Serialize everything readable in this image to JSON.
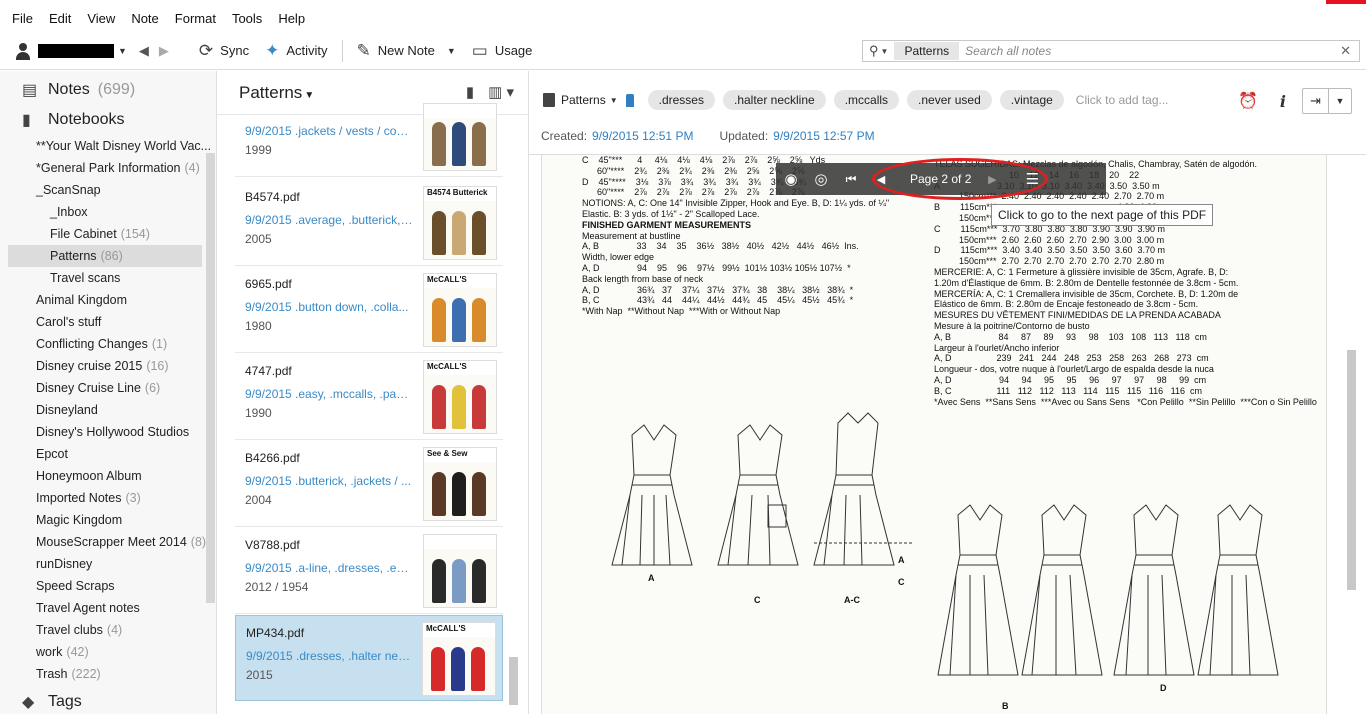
{
  "menu": [
    "File",
    "Edit",
    "View",
    "Note",
    "Format",
    "Tools",
    "Help"
  ],
  "toolbar": {
    "sync_label": "Sync",
    "activity_label": "Activity",
    "new_note_label": "New Note",
    "usage_label": "Usage"
  },
  "search": {
    "scope_tag": "Patterns",
    "placeholder": "Search all notes"
  },
  "sidebar": {
    "notes_label": "Notes",
    "notes_count": "(699)",
    "notebooks_label": "Notebooks",
    "tags_label": "Tags",
    "notebooks": [
      {
        "label": "**Your Walt Disney World Vac...",
        "count": "",
        "level": 0
      },
      {
        "label": "*General Park Information",
        "count": "(4)",
        "level": 0
      },
      {
        "label": "_ScanSnap",
        "count": "",
        "level": 0
      },
      {
        "label": "_Inbox",
        "count": "",
        "level": 1
      },
      {
        "label": "File Cabinet",
        "count": "(154)",
        "level": 1
      },
      {
        "label": "Patterns",
        "count": "(86)",
        "level": 1,
        "selected": true
      },
      {
        "label": "Travel scans",
        "count": "",
        "level": 1
      },
      {
        "label": "Animal Kingdom",
        "count": "",
        "level": 0
      },
      {
        "label": "Carol's stuff",
        "count": "",
        "level": 0
      },
      {
        "label": "Conflicting Changes",
        "count": "(1)",
        "level": 0
      },
      {
        "label": "Disney cruise 2015",
        "count": "(16)",
        "level": 0
      },
      {
        "label": "Disney Cruise Line",
        "count": "(6)",
        "level": 0
      },
      {
        "label": "Disneyland",
        "count": "",
        "level": 0
      },
      {
        "label": "Disney's Hollywood Studios",
        "count": "",
        "level": 0
      },
      {
        "label": "Epcot",
        "count": "",
        "level": 0
      },
      {
        "label": "Honeymoon Album",
        "count": "",
        "level": 0
      },
      {
        "label": "Imported Notes",
        "count": "(3)",
        "level": 0
      },
      {
        "label": "Magic Kingdom",
        "count": "",
        "level": 0
      },
      {
        "label": "MouseScrapper Meet 2014",
        "count": "(8)",
        "level": 0
      },
      {
        "label": "runDisney",
        "count": "",
        "level": 0
      },
      {
        "label": "Speed Scraps",
        "count": "",
        "level": 0
      },
      {
        "label": "Travel Agent notes",
        "count": "",
        "level": 0
      },
      {
        "label": "Travel clubs",
        "count": "(4)",
        "level": 0
      },
      {
        "label": "work",
        "count": "(42)",
        "level": 0
      },
      {
        "label": "Trash",
        "count": "(222)",
        "level": 0
      }
    ]
  },
  "notelist": {
    "title": "Patterns",
    "notes": [
      {
        "title": "",
        "meta": "9/9/2015  .jackets / vests / coa...",
        "year": "1999",
        "thumb_label": "",
        "colors": [
          "#8a6d4a",
          "#2e4a7a"
        ]
      },
      {
        "title": "B4574.pdf",
        "meta": "9/9/2015  .average, .butterick, ...",
        "year": "2005",
        "thumb_label": "B4574 Butterick",
        "colors": [
          "#6b4f2a",
          "#c9a874"
        ]
      },
      {
        "title": "6965.pdf",
        "meta": "9/9/2015  .button down, .colla...",
        "year": "1980",
        "thumb_label": "McCALL'S",
        "colors": [
          "#d98a2b",
          "#3d6fb0"
        ]
      },
      {
        "title": "4747.pdf",
        "meta": "9/9/2015  .easy, .mccalls, .pant...",
        "year": "1990",
        "thumb_label": "McCALL'S",
        "colors": [
          "#c83a3a",
          "#e2c23a"
        ]
      },
      {
        "title": "B4266.pdf",
        "meta": "9/9/2015  .butterick, .jackets / ...",
        "year": "2004",
        "thumb_label": "See & Sew",
        "colors": [
          "#5a3a26",
          "#1e1e1e"
        ]
      },
      {
        "title": "V8788.pdf",
        "meta": "9/9/2015  .a-line, .dresses, .eas...",
        "year": "2012 / 1954",
        "thumb_label": "",
        "colors": [
          "#2a2a2a",
          "#7a9bc4"
        ]
      },
      {
        "title": "MP434.pdf",
        "meta": "9/9/2015  .dresses, .halter neck...",
        "year": "2015",
        "thumb_label": "McCALL'S",
        "colors": [
          "#d62a2a",
          "#2a3a8a"
        ],
        "selected": true
      }
    ]
  },
  "note": {
    "notebook": "Patterns",
    "tags": [
      ".dresses",
      ".halter neckline",
      ".mccalls",
      ".never used",
      ".vintage"
    ],
    "add_tag": "Click to add tag...",
    "created_label": "Created:",
    "created": "9/9/2015 12:51 PM",
    "updated_label": "Updated:",
    "updated": "9/9/2015 12:57 PM"
  },
  "pdf": {
    "page_indicator": "Page 2 of 2",
    "tooltip": "Click to go to the next page of this PDF",
    "left_table": [
      "C    45\"***      4     4⅛    4⅛    4⅛    2⅞    2⅞    2⅝    2⅝   Yds",
      "      60\"****    2¾    2⅜    2¾    2⅜    2⅜    2⅝    2⅝    2⅝",
      "D    45\"****    3⅛    3⅞    3¾    3¾    3¾    3¾    3¾    3¾",
      "      60\"****    2⅞    2⅞    2⅞    2⅞    2⅞    2⅞    2⅞    2⅞",
      "NOTIONS: A, C: One 14\" Invisible Zipper, Hook and Eye. B, D: 1¼ yds. of ¼\"",
      "Elastic. B: 3 yds. of 1½\" - 2\" Scalloped Lace.",
      "FINISHED GARMENT MEASUREMENTS",
      "Measurement at bustline",
      "A, B               33    34    35    36½   38½   40½   42½   44½   46½  Ins.",
      "Width, lower edge",
      "A, D               94    95    96    97½   99½  101½ 103½ 105½ 107½  *",
      "Back length from base of neck",
      "A, D               36¾   37    37¼   37½   37¾   38    38¼   38½   38¾  *",
      "B, C               43¾   44    44¼   44½   44¾   45    45¼   45½   45¾  *",
      "",
      "*With Nap  **Without Nap  ***With or Without Nap"
    ],
    "right_table": [
      "TELAS SUGERIDAS: Mezclas de algodón, Chalis, Chambray, Satén de algodón.",
      "                              10    12    14    16    18    20    22",
      "A                       3.10  3.10  3.10  3.40  3.40  3.50  3.50 m",
      "          150cm***  2.40  2.40  2.40  2.40  2.40  2.70  2.70 m",
      "B        115cm***                                                4.30  4.30 m",
      "          150cm***                                                3.80  3.80 m",
      "C        115cm***  3.70  3.80  3.80  3.80  3.90  3.90  3.90 m",
      "          150cm***  2.60  2.60  2.60  2.70  2.90  3.00  3.00 m",
      "D        115cm***  3.40  3.40  3.50  3.50  3.50  3.60  3.70 m",
      "          150cm***  2.70  2.70  2.70  2.70  2.70  2.70  2.80 m",
      "MERCERIE: A, C: 1 Fermeture à glissière invisible de 35cm, Agrafe. B, D:",
      "1.20m d'Élastique de 6mm. B: 2.80m de Dentelle festonnée de 3.8cm - 5cm.",
      "MERCERÍA: A, C: 1 Cremallera invisible de 35cm, Corchete. B, D: 1.20m de",
      "Elástico de 6mm. B: 2.80m de Encaje festoneado de 3.8cm - 5cm.",
      "MESURES DU VÊTEMENT FINI/MEDIDAS DE LA PRENDA ACABADA",
      "Mesure à la poitrine/Contorno de busto",
      "A, B                   84     87     89     93     98    103   108   113   118  cm",
      "Largeur à l'ourlet/Ancho inferior",
      "A, D                  239   241   244   248   253   258   263   268   273  cm",
      "Longueur - dos, votre nuque à l'ourlet/Largo de espalda desde la nuca",
      "A, D                   94     94     95     95     96     97     97     98     99  cm",
      "B, C                  111   112   112   113   114   115   115   116   116  cm",
      "",
      "*Avec Sens  **Sans Sens  ***Avec ou Sans Sens   *Con Pelillo  **Sin Pelillo  ***Con o Sin Pelillo"
    ],
    "view_labels": [
      "A",
      "C",
      "A-C",
      "A",
      "C",
      "B",
      "D"
    ]
  }
}
